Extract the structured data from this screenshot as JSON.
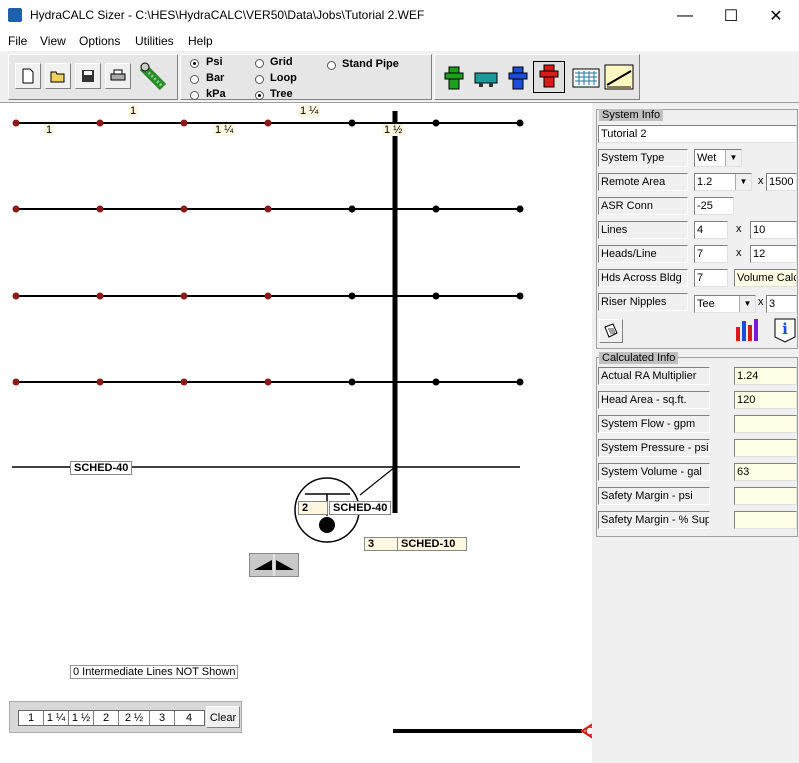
{
  "window": {
    "title": "HydraCALC Sizer - C:\\HES\\HydraCALC\\VER50\\Data\\Jobs\\Tutorial 2.WEF",
    "minimize": "—",
    "maximize": "☐",
    "close": "✕"
  },
  "menu": [
    "File",
    "View",
    "Options",
    "Utilities",
    "Help"
  ],
  "units": [
    "Psi",
    "Bar",
    "kPa"
  ],
  "units_selected": "Psi",
  "layout_types": [
    "Grid",
    "Loop",
    "Tree"
  ],
  "layout_selected": "Tree",
  "stand_pipe": "Stand Pipe",
  "canvas": {
    "pipe_labels": {
      "top_1": "1",
      "top_1q": "1 ¼",
      "branch_1": "1",
      "branch_1q": "1 ¼",
      "riser_1h": "1 ½",
      "sched40_main": "SCHED-40",
      "riser_num": "2",
      "riser_sched": "SCHED-40",
      "bottom_num": "3",
      "bottom_sched": "SCHED-10"
    },
    "intermediate_note": "0 Intermediate Lines NOT Shown"
  },
  "pipe_sizes": [
    "1",
    "1 ¼",
    "1 ½",
    "2",
    "2 ½",
    "3",
    "4"
  ],
  "clear_label": "Clear",
  "system_info": {
    "title": "System Info",
    "job_name": "Tutorial 2",
    "system_type_label": "System Type",
    "system_type": "Wet",
    "remote_area_label": "Remote Area",
    "remote_area": "1.2",
    "remote_area_x": "x",
    "remote_area_sqft": "1500",
    "asr_label": "ASR Conn",
    "asr": "-25",
    "lines_label": "Lines",
    "lines": "4",
    "lines_x": "x",
    "lines_spacing": "10",
    "heads_label": "Heads/Line",
    "heads": "7",
    "heads_x": "x",
    "heads_spacing": "12",
    "hds_across_label": "Hds Across Bldg",
    "hds_across": "7",
    "volume_calc": "Volume Calc",
    "riser_nipples_label": "Riser Nipples",
    "riser_nipples": "Tee",
    "riser_nipples_x": "x",
    "riser_nipples_val": "3"
  },
  "calculated_info": {
    "title": "Calculated Info",
    "rows": [
      {
        "label": "Actual RA Multiplier",
        "value": "1.24"
      },
      {
        "label": "Head Area - sq.ft.",
        "value": "120"
      },
      {
        "label": "System Flow - gpm",
        "value": ""
      },
      {
        "label": "System Pressure - psi",
        "value": ""
      },
      {
        "label": "System Volume - gal",
        "value": "63"
      },
      {
        "label": "Safety Margin - psi",
        "value": ""
      },
      {
        "label": "Safety Margin - % Sup",
        "value": ""
      }
    ]
  },
  "colors": {
    "head_red": "#8b1a1a",
    "hydrant_green": "#1aa01a",
    "hydrant_blue": "#1a4ed8",
    "hydrant_red": "#d81a1a",
    "label_bg": "#fff8e0",
    "output_bg": "#ffffe6"
  }
}
